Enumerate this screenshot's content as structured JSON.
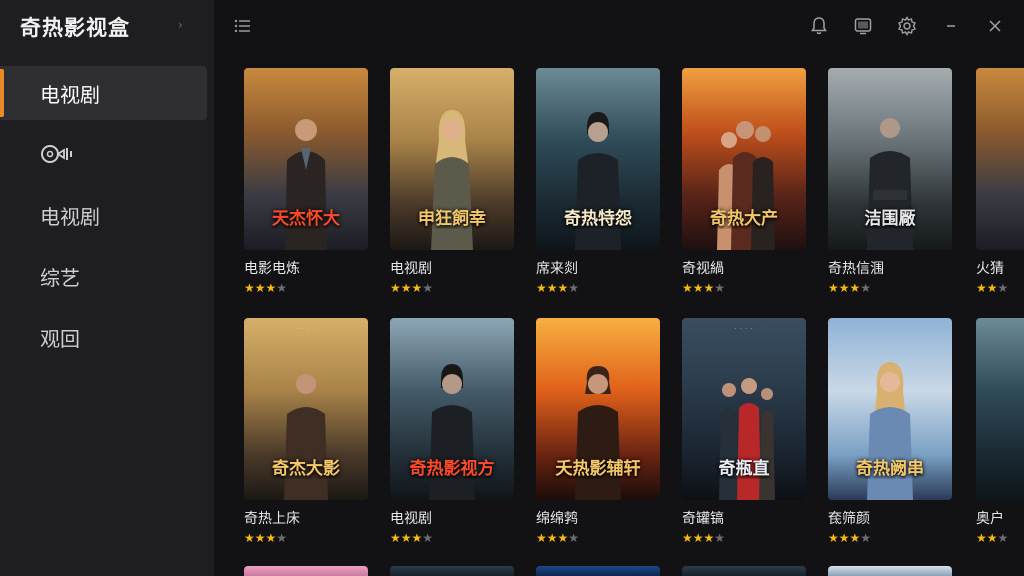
{
  "app": {
    "title": "奇热影视盒"
  },
  "sidebar": {
    "items": [
      {
        "label": "电视剧",
        "active": true
      },
      {
        "label": "",
        "icon": "movie-icon",
        "active": false
      },
      {
        "label": "电视剧",
        "active": false
      },
      {
        "label": "综艺",
        "active": false
      },
      {
        "label": "观回",
        "active": false
      }
    ]
  },
  "topbar": {
    "icons": [
      "menu-icon",
      "notification-bell-icon",
      "screen-icon",
      "settings-gear-icon",
      "minimize-icon",
      "close-icon"
    ]
  },
  "colors": {
    "accent": "#e8892a",
    "star_on": "#f5b916",
    "star_off": "#6d6d72",
    "sidebar_bg": "#1e1e22",
    "main_bg": "#121215"
  },
  "grid": {
    "row1": [
      {
        "poster_title": "天杰怀大",
        "caption": "电影电炼",
        "rating": 3,
        "max": 4
      },
      {
        "poster_title": "申狂飼幸",
        "caption": "电视剧",
        "rating": 3,
        "max": 4
      },
      {
        "poster_title": "奇热特怨",
        "caption": "席来剡",
        "rating": 3,
        "max": 4
      },
      {
        "poster_title": "奇热大产",
        "caption": "奇视緺",
        "rating": 3,
        "max": 4
      },
      {
        "poster_title": "洁围厰",
        "caption": "奇热信涠",
        "rating": 3,
        "max": 4
      },
      {
        "poster_title": "",
        "caption": "火猜",
        "rating": 2,
        "max": 4
      }
    ],
    "row2": [
      {
        "poster_title": "奇杰大影",
        "caption": "奇热上床",
        "rating": 3,
        "max": 4
      },
      {
        "poster_title": "奇热影视方",
        "caption": "电视剧",
        "rating": 3,
        "max": 4
      },
      {
        "poster_title": "夭热影辅轩",
        "caption": "绵绵鹁",
        "rating": 3,
        "max": 4
      },
      {
        "poster_title": "奇瓶直",
        "caption": "奇罐镐",
        "rating": 3,
        "max": 4
      },
      {
        "poster_title": "奇热阙串",
        "caption": "奃筛颜",
        "rating": 3,
        "max": 4
      },
      {
        "poster_title": "",
        "caption": "奥户",
        "rating": 2,
        "max": 4
      }
    ]
  }
}
